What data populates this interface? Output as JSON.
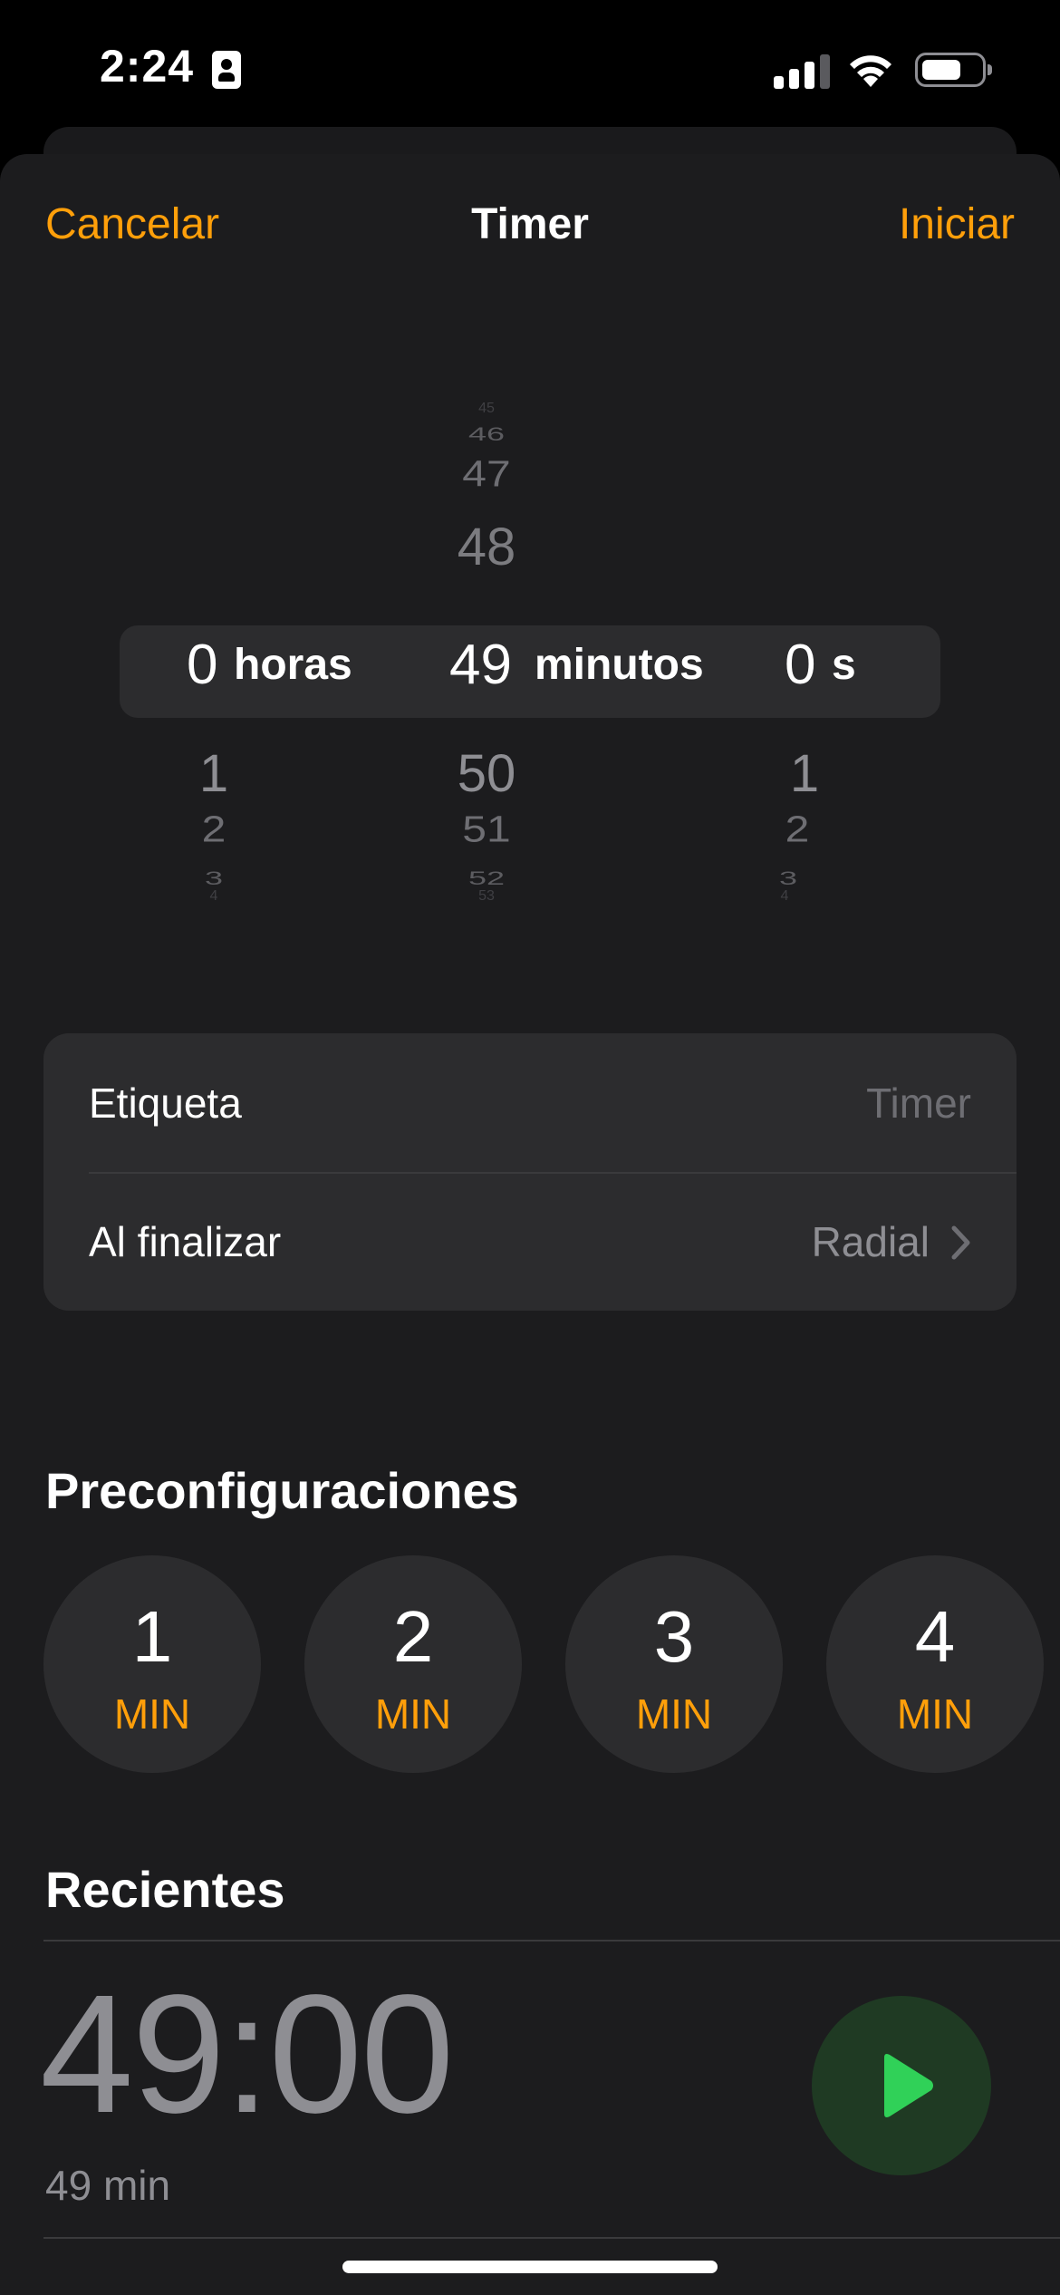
{
  "status_bar": {
    "time": "2:24"
  },
  "nav": {
    "cancel": "Cancelar",
    "title": "Timer",
    "start": "Iniciar"
  },
  "picker": {
    "hours": {
      "above": [],
      "selected": "0",
      "unit": "horas",
      "below": [
        "1",
        "2",
        "3",
        "4"
      ]
    },
    "minutes": {
      "above": [
        "45",
        "46",
        "47",
        "48"
      ],
      "selected": "49",
      "unit": "minutos",
      "below": [
        "50",
        "51",
        "52",
        "53"
      ]
    },
    "seconds": {
      "above": [],
      "selected": "0",
      "unit": "s",
      "below": [
        "1",
        "2",
        "3",
        "4"
      ]
    }
  },
  "settings": {
    "label_row": {
      "label": "Etiqueta",
      "placeholder": "Timer"
    },
    "end_row": {
      "label": "Al finalizar",
      "value": "Radial"
    }
  },
  "presets": {
    "heading": "Preconfiguraciones",
    "items": [
      {
        "num": "1",
        "unit": "MIN"
      },
      {
        "num": "2",
        "unit": "MIN"
      },
      {
        "num": "3",
        "unit": "MIN"
      },
      {
        "num": "4",
        "unit": "MIN"
      }
    ]
  },
  "recents": {
    "heading": "Recientes",
    "items": [
      {
        "time": "49:00",
        "label": "49 min"
      }
    ]
  },
  "colors": {
    "accent": "#ff9f0a",
    "background": "#1c1c1e",
    "cell": "#2c2c2e",
    "play_bg": "#1f3a23",
    "play_icon": "#30d158"
  }
}
